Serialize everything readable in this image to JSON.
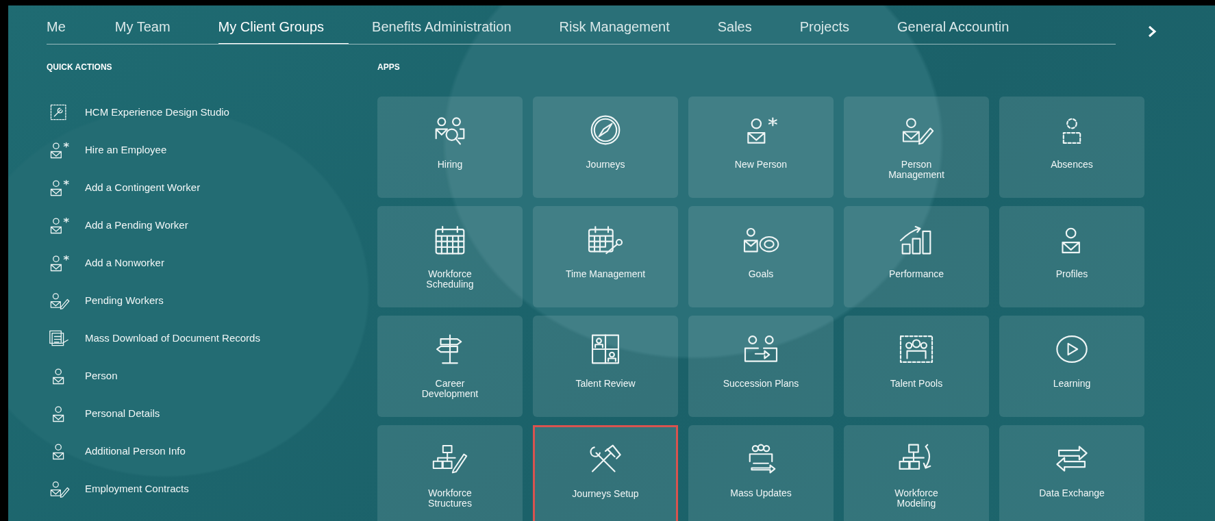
{
  "tabs": [
    {
      "label": "Me",
      "selected": false
    },
    {
      "label": "My Team",
      "selected": false
    },
    {
      "label": "My Client Groups",
      "selected": true
    },
    {
      "label": "Benefits Administration",
      "selected": false
    },
    {
      "label": "Risk Management",
      "selected": false
    },
    {
      "label": "Sales",
      "selected": false
    },
    {
      "label": "Projects",
      "selected": false
    },
    {
      "label": "General Accountin",
      "selected": false
    }
  ],
  "quick_actions": {
    "title": "QUICK ACTIONS",
    "items": [
      {
        "label": "HCM Experience Design Studio"
      },
      {
        "label": "Hire an Employee"
      },
      {
        "label": "Add a Contingent Worker"
      },
      {
        "label": "Add a Pending Worker"
      },
      {
        "label": "Add a Nonworker"
      },
      {
        "label": "Pending Workers"
      },
      {
        "label": "Mass Download of Document Records"
      },
      {
        "label": "Person"
      },
      {
        "label": "Personal Details"
      },
      {
        "label": "Additional Person Info"
      },
      {
        "label": "Employment Contracts"
      }
    ]
  },
  "apps": {
    "title": "APPS",
    "tiles": [
      {
        "label": "Hiring",
        "highlighted": false
      },
      {
        "label": "Journeys",
        "highlighted": false
      },
      {
        "label": "New Person",
        "highlighted": false
      },
      {
        "label": "Person Management",
        "highlighted": false
      },
      {
        "label": "Absences",
        "highlighted": false
      },
      {
        "label": "Workforce Scheduling",
        "highlighted": false
      },
      {
        "label": "Time Management",
        "highlighted": false
      },
      {
        "label": "Goals",
        "highlighted": false
      },
      {
        "label": "Performance",
        "highlighted": false
      },
      {
        "label": "Profiles",
        "highlighted": false
      },
      {
        "label": "Career Development",
        "highlighted": false
      },
      {
        "label": "Talent Review",
        "highlighted": false
      },
      {
        "label": "Succession Plans",
        "highlighted": false
      },
      {
        "label": "Talent Pools",
        "highlighted": false
      },
      {
        "label": "Learning",
        "highlighted": false
      },
      {
        "label": "Workforce Structures",
        "highlighted": false
      },
      {
        "label": "Journeys Setup",
        "highlighted": true
      },
      {
        "label": "Mass Updates",
        "highlighted": false
      },
      {
        "label": "Workforce Modeling",
        "highlighted": false
      },
      {
        "label": "Data Exchange",
        "highlighted": false
      }
    ]
  }
}
